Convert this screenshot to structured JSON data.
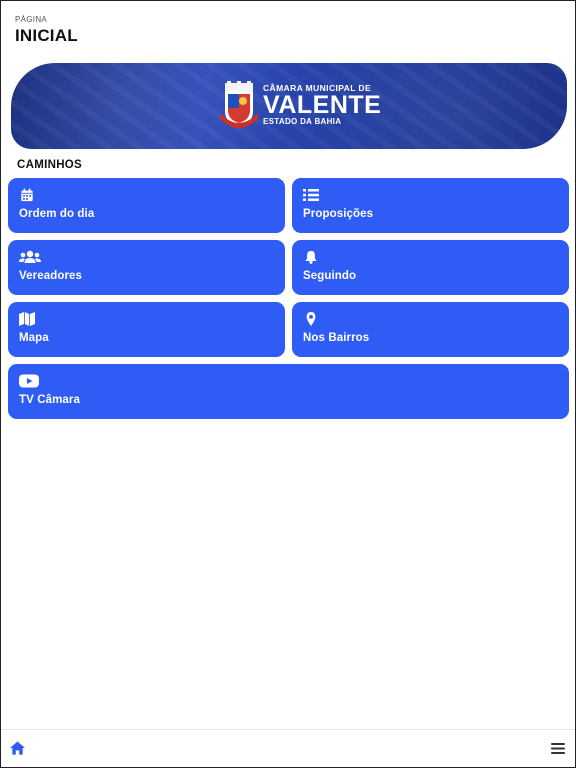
{
  "header": {
    "kicker": "PÁGINA",
    "title": "INICIAL"
  },
  "banner": {
    "line1": "CÂMARA MUNICIPAL DE",
    "line2": "VALENTE",
    "line3": "ESTADO DA BAHIA"
  },
  "section": {
    "title": "CAMINHOS"
  },
  "tiles": [
    {
      "label": "Ordem do dia",
      "icon": "calendar-icon"
    },
    {
      "label": "Proposições",
      "icon": "list-icon"
    },
    {
      "label": "Vereadores",
      "icon": "users-icon"
    },
    {
      "label": "Seguindo",
      "icon": "bell-icon"
    },
    {
      "label": "Mapa",
      "icon": "map-icon"
    },
    {
      "label": "Nos Bairros",
      "icon": "map-pin-icon"
    },
    {
      "label": "TV Câmara",
      "icon": "youtube-icon"
    }
  ],
  "bottom_nav": {
    "left_icon": "home-icon",
    "right_icon": "hamburger-menu-icon"
  },
  "colors": {
    "tile": "#2e5cf5",
    "banner": "#1f3b9e",
    "home_icon": "#2e5cf5"
  }
}
